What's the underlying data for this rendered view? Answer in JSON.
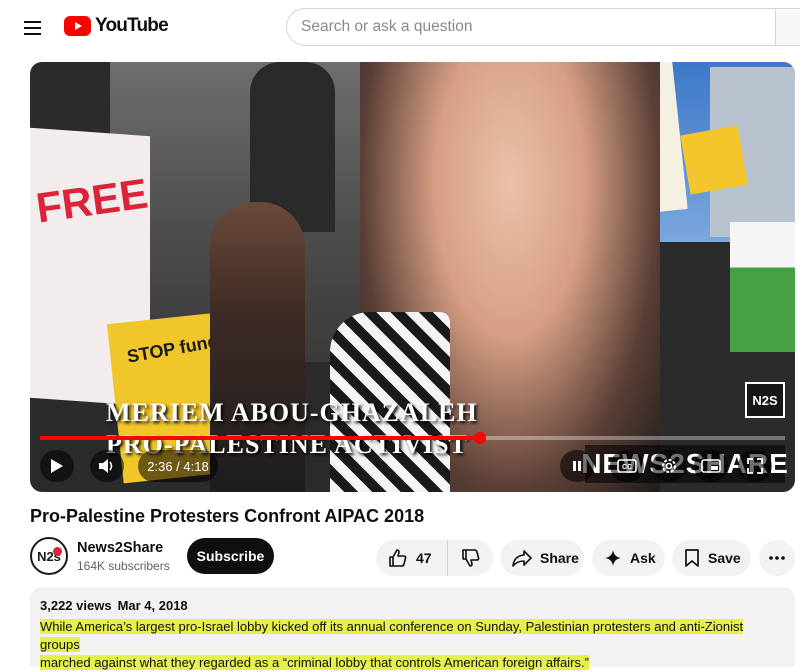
{
  "header": {
    "logo_text": "YouTube",
    "search_placeholder": "Search or ask a question"
  },
  "video": {
    "caption_name": "MERIEM ABOU-GHAZALEH",
    "caption_role": "PRO-PALESTINE ACTIVIST",
    "sign_left_text": "FREE",
    "sign_yellow_text": "STOP funding PAL",
    "watermark_logo": "N2S",
    "watermark_text": "NEWS2SHARE",
    "progress_fraction": 0.59,
    "current_time": "2:36",
    "duration": "4:18",
    "time_display": "2:36 / 4:18",
    "progress_color": "#ff0000"
  },
  "title": "Pro-Palestine Protesters Confront AIPAC 2018",
  "channel": {
    "avatar_text": "N2s",
    "name": "News2Share",
    "subscribers": "164K subscribers",
    "subscribe_label": "Subscribe"
  },
  "actions": {
    "likes": "47",
    "share_label": "Share",
    "ask_label": "Ask",
    "save_label": "Save"
  },
  "description": {
    "views": "3,222 views",
    "date": "Mar 4, 2018",
    "text_line1": "While America’s largest pro-Israel lobby kicked off its annual conference on Sunday, Palestinian protesters and anti-Zionist groups",
    "text_line2": "marched against what they regarded as a “criminal lobby that controls American foreign affairs.”",
    "highlight_color": "#e6f04a"
  },
  "icons": {
    "menu": "menu-icon",
    "logo": "youtube-logo-icon",
    "play": "play-icon",
    "volume": "volume-icon",
    "pause": "pause-icon",
    "cc": "closed-captions-icon",
    "settings": "gear-icon",
    "miniplayer": "miniplayer-icon",
    "fullscreen": "fullscreen-icon",
    "like": "thumbs-up-icon",
    "dislike": "thumbs-down-icon",
    "share": "share-icon",
    "ask": "sparkle-icon",
    "save": "save-icon",
    "more": "more-icon"
  }
}
